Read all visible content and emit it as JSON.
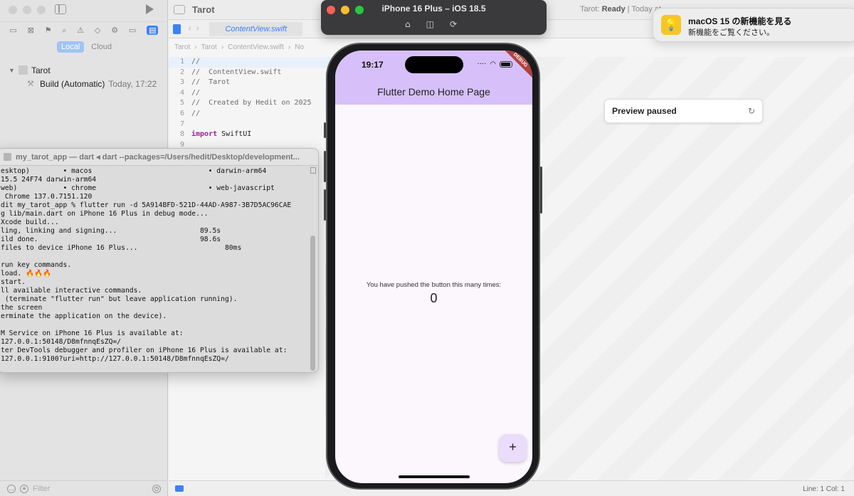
{
  "navigator": {
    "scope_local": "Local",
    "scope_cloud": "Cloud",
    "project_name": "Tarot",
    "build_label": "Build (Automatic)",
    "build_time": "Today, 17:22",
    "filter_placeholder": "Filter"
  },
  "editor": {
    "window_title": "Tarot",
    "status_prefix": "Tarot: ",
    "status_state": "Ready",
    "status_suffix": " | Today at",
    "tab_label": "ContentView.swift",
    "breadcrumb": [
      "Tarot",
      "Tarot",
      "ContentView.swift",
      "No"
    ],
    "code_lines": [
      {
        "n": "1",
        "text": "//"
      },
      {
        "n": "2",
        "text": "//  ContentView.swift"
      },
      {
        "n": "3",
        "text": "//  Tarot"
      },
      {
        "n": "4",
        "text": "//"
      },
      {
        "n": "5",
        "text": "//  Created by Hedit on 2025"
      },
      {
        "n": "6",
        "text": "//"
      },
      {
        "n": "7",
        "text": ""
      },
      {
        "n": "8",
        "kw": "import",
        "text": " SwiftUI"
      },
      {
        "n": "9",
        "text": ""
      }
    ],
    "cursor_position": "Line: 1  Col: 1"
  },
  "preview": {
    "paused_label": "Preview paused"
  },
  "terminal": {
    "title": "my_tarot_app — dart ◂ dart --packages=/Users/hedit/Desktop/development...",
    "output": "esktop)        • macos                            • darwin-arm64\n15.5 24F74 darwin-arm64\nweb)           • chrome                           • web-javascript\n Chrome 137.0.7151.120\ndit my_tarot_app % flutter run -d 5A914BFD-521D-44AD-A987-3B7D5AC96CAE\ng lib/main.dart on iPhone 16 Plus in debug mode...\nXcode build...\nling, linking and signing...                    89.5s\nild done.                                       98.6s\nfiles to device iPhone 16 Plus...                     80ms\n\nrun key commands.\nload. 🔥🔥🔥\nstart.\nll available interactive commands.\n (terminate \"flutter run\" but leave application running).\nthe screen\nerminate the application on the device).\n\nM Service on iPhone 16 Plus is available at:\n127.0.0.1:50148/D8mfnnqEsZQ=/\nter DevTools debugger and profiler on iPhone 16 Plus is available at:\n127.0.0.1:9100?uri=http://127.0.0.1:50148/D8mfnnqEsZQ=/"
  },
  "simulator": {
    "title": "iPhone 16 Plus – iOS 18.5",
    "status_time": "19:17",
    "debug_banner": "DEBUG",
    "app_title": "Flutter Demo Home Page",
    "message": "You have pushed the button this many times:",
    "counter": "0",
    "fab_label": "+"
  },
  "notification": {
    "title": "macOS 15 の新機能を見る",
    "body": "新機能をご覧ください。"
  },
  "colors": {
    "appbar": "#d7c0fa",
    "fab": "#ecdcfb",
    "accent": "#3b82f6",
    "keyword": "#9b2393"
  }
}
